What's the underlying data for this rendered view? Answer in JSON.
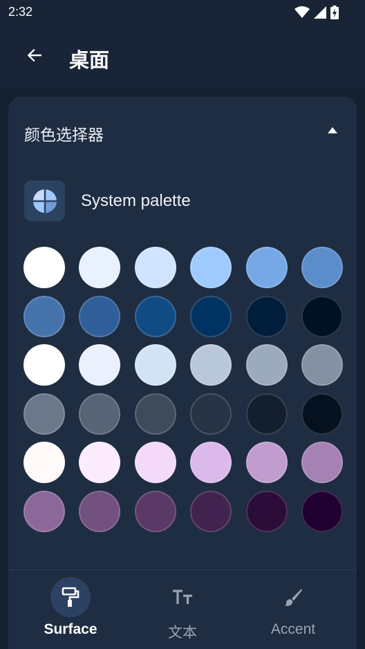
{
  "status_bar": {
    "time": "2:32",
    "icons": [
      "wifi-icon",
      "cellular-signal-icon",
      "battery-charging-icon"
    ]
  },
  "app_bar": {
    "back_icon": "arrow-left-icon",
    "title": "桌面"
  },
  "section": {
    "title": "颜色选择器",
    "expanded": true,
    "collapse_icon": "triangle-up-icon"
  },
  "palette": {
    "label": "System palette",
    "icon": "palette-quadrant-icon"
  },
  "swatches": [
    [
      "#ffffff",
      "#eaf1fe",
      "#d1e4ff",
      "#9fcaff",
      "#76a8e6",
      "#5b8dcb"
    ],
    [
      "#4773ad",
      "#2f5e99",
      "#104c83",
      "#003362",
      "#001d3b",
      "#001124"
    ],
    [
      "#ffffff",
      "#eaf1fd",
      "#d3e3f6",
      "#b8c7da",
      "#9caabd",
      "#8391a3"
    ],
    [
      "#6a7889",
      "#566475",
      "#3e4b5b",
      "#273445",
      "#131f2e",
      "#05111e"
    ],
    [
      "#fffaf9",
      "#fcecfe",
      "#f4d9fb",
      "#dcb9eb",
      "#c09ccf",
      "#a581b4"
    ],
    [
      "#8b6899",
      "#72507f",
      "#5a3967",
      "#42234f",
      "#2c0c39",
      "#200030"
    ]
  ],
  "bottom_nav": {
    "items": [
      {
        "label": "Surface",
        "icon": "paint-roller-icon",
        "active": true
      },
      {
        "label": "文本",
        "icon": "text-size-icon",
        "active": false
      },
      {
        "label": "Accent",
        "icon": "brush-icon",
        "active": false
      }
    ]
  },
  "colors": {
    "background": "#14202f",
    "app_bar": "#192536",
    "card": "#1f2d42",
    "active_indicator": "#2d4262"
  }
}
